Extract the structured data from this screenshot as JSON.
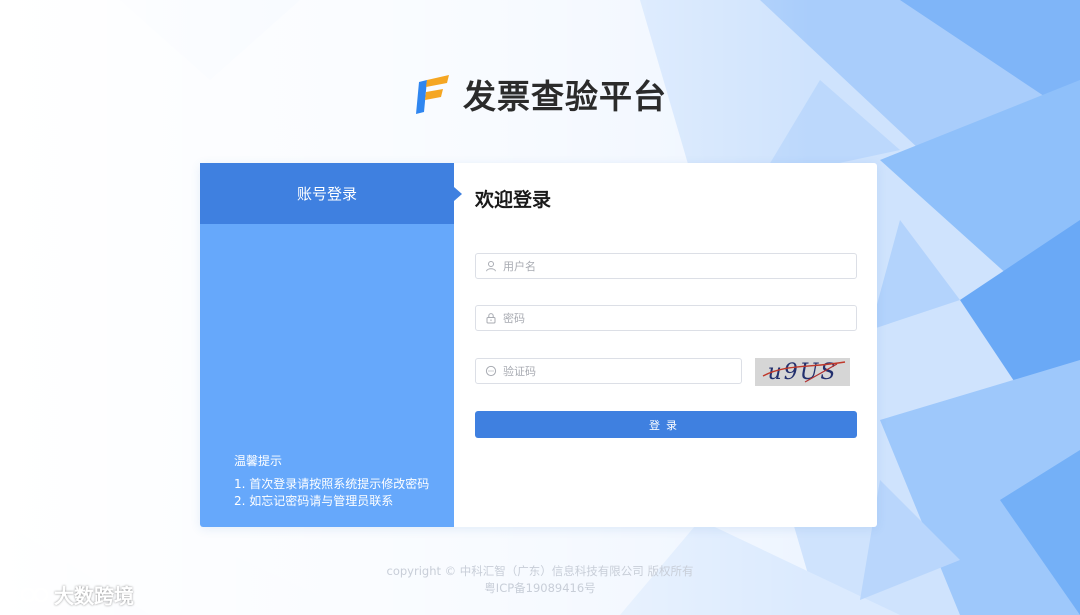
{
  "header": {
    "title": "发票查验平台",
    "logo_icon": "invoice-platform-logo-icon"
  },
  "left_panel": {
    "tab_label": "账号登录",
    "tips_title": "温馨提示",
    "tips": [
      "1. 首次登录请按照系统提示修改密码",
      "2. 如忘记密码请与管理员联系"
    ]
  },
  "form": {
    "title": "欢迎登录",
    "username": {
      "placeholder": "用户名",
      "value": "",
      "icon": "user-icon"
    },
    "password": {
      "placeholder": "密码",
      "value": "",
      "icon": "lock-icon"
    },
    "captcha": {
      "placeholder": "验证码",
      "value": "",
      "icon": "chat-bubble-icon",
      "image_text": "u9US"
    },
    "login_label": "登录"
  },
  "footer": {
    "copyright": "copyright © 中科汇智（广东）信息科技有限公司 版权所有",
    "icp": "粤ICP备19089416号"
  },
  "watermark": {
    "text": "大数跨境"
  },
  "colors": {
    "primary": "#3f80e0",
    "panel": "#66a8fb",
    "logo_blue": "#2f86f0",
    "logo_orange": "#f5a623"
  }
}
